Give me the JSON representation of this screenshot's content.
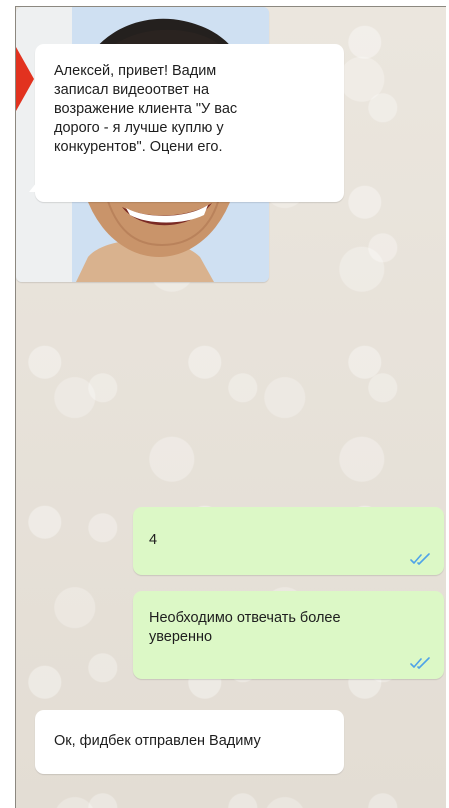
{
  "chat": {
    "messages": [
      {
        "direction": "incoming",
        "text": "Алексей, привет! Вадим\nзаписал видеоответ на\nвозражение клиента \"У вас\nдорого - я лучше куплю у\nконкурентов\". Оцени его."
      },
      {
        "direction": "incoming",
        "type": "photo"
      },
      {
        "direction": "outgoing",
        "text": "4",
        "status_icon": "double-check-icon"
      },
      {
        "direction": "outgoing",
        "text": "Необходимо отвечать более\nуверенно",
        "status_icon": "double-check-icon"
      },
      {
        "direction": "incoming",
        "text": "Ок, фидбек отправлен Вадиму"
      }
    ]
  },
  "colors": {
    "chat_background": "#e7e1d9",
    "incoming_bubble": "#ffffff",
    "outgoing_bubble": "#dcf8c6",
    "read_ticks": "#4fa3e8"
  }
}
